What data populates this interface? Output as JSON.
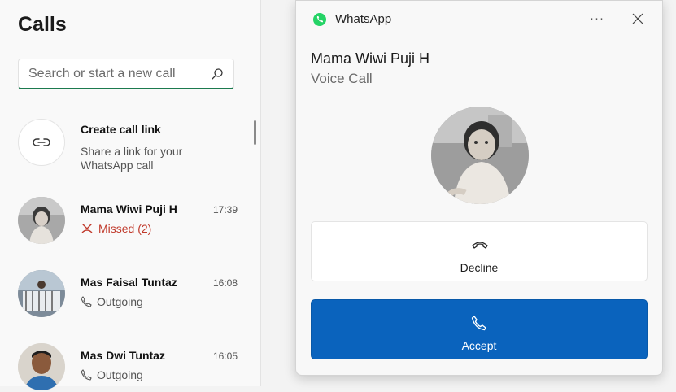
{
  "calls_panel": {
    "title": "Calls",
    "search": {
      "placeholder": "Search or start a new call",
      "value": ""
    },
    "create_link": {
      "title": "Create call link",
      "subtitle_line1": "Share a link for your",
      "subtitle_line2": "WhatsApp call"
    },
    "entries": [
      {
        "name": "Mama Wiwi Puji H",
        "time": "17:39",
        "status": "Missed (2)",
        "status_type": "missed"
      },
      {
        "name": "Mas Faisal Tuntaz",
        "time": "16:08",
        "status": "Outgoing",
        "status_type": "outgoing"
      },
      {
        "name": "Mas Dwi Tuntaz",
        "time": "16:05",
        "status": "Outgoing",
        "status_type": "outgoing"
      }
    ]
  },
  "call_window": {
    "app_name": "WhatsApp",
    "more_label": "···",
    "caller_name": "Mama Wiwi Puji H",
    "call_type": "Voice Call",
    "decline_label": "Decline",
    "accept_label": "Accept"
  },
  "colors": {
    "accent_green": "#1c7a4e",
    "whatsapp_green": "#25d366",
    "missed_red": "#c0392b",
    "accept_blue": "#0a63bd"
  },
  "icons": {
    "search": "search-icon",
    "link": "link-icon",
    "missed": "missed-call-icon",
    "outgoing": "phone-outgoing-icon",
    "app": "whatsapp-icon",
    "close": "close-icon",
    "decline": "phone-hangup-icon",
    "accept": "phone-icon"
  }
}
